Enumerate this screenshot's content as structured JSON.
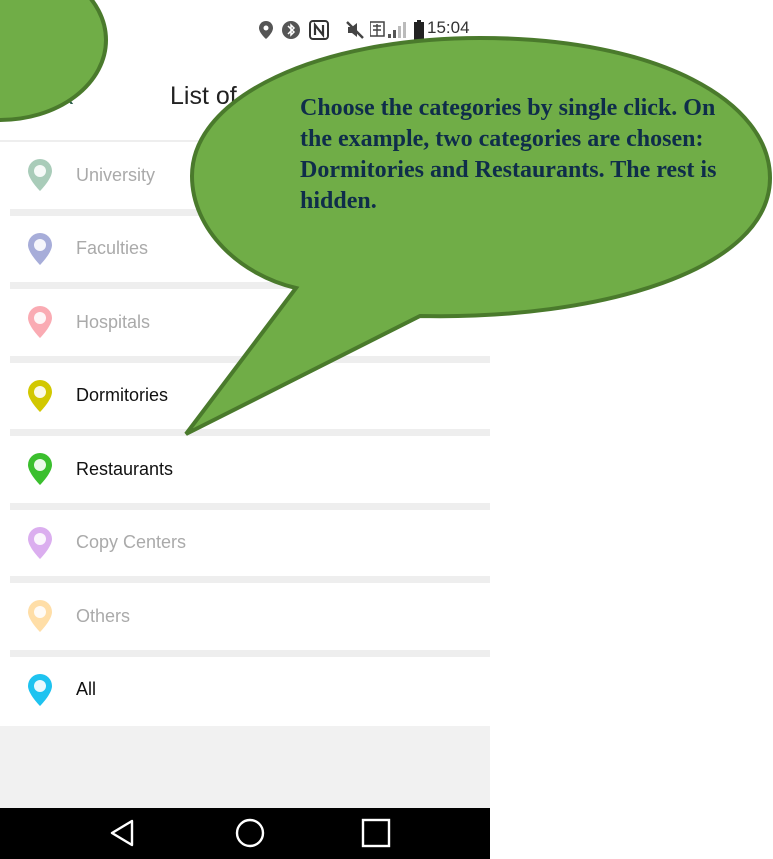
{
  "status_bar": {
    "time": "15:04",
    "icons": [
      "location-icon",
      "bluetooth-icon",
      "nfc-icon",
      "mute-icon",
      "lte-signal-icon",
      "battery-icon"
    ]
  },
  "header": {
    "back_label": "< Back",
    "title": "List of"
  },
  "categories": [
    {
      "label": "University",
      "color": "#1f7a4a",
      "icon": "university-pin-icon",
      "active": false
    },
    {
      "label": "Faculties",
      "color": "#1a2a9e",
      "icon": "faculties-pin-icon",
      "active": false
    },
    {
      "label": "Hospitals",
      "color": "#f4243a",
      "icon": "hospitals-pin-icon",
      "active": false
    },
    {
      "label": "Dormitories",
      "color": "#d2c800",
      "icon": "dormitories-pin-icon",
      "active": true
    },
    {
      "label": "Restaurants",
      "color": "#3bbf2e",
      "icon": "restaurants-pin-icon",
      "active": true
    },
    {
      "label": "Copy Centers",
      "color": "#a12dd6",
      "icon": "copy-centers-pin-icon",
      "active": false
    },
    {
      "label": "Others",
      "color": "#ffa91a",
      "icon": "others-pin-icon",
      "active": false
    },
    {
      "label": "All",
      "color": "#1ec3f0",
      "icon": "all-pin-icon",
      "active": true
    }
  ],
  "callout": {
    "text": "Choose the categories by single click. On the example, two categories are chosen: Dormitories and Restaurants. The rest is hidden.",
    "fill_color": "#70ad47",
    "border_color": "#4a7a2c"
  },
  "nav_bar": {
    "buttons": [
      "back-triangle-icon",
      "home-circle-icon",
      "recents-square-icon"
    ]
  }
}
